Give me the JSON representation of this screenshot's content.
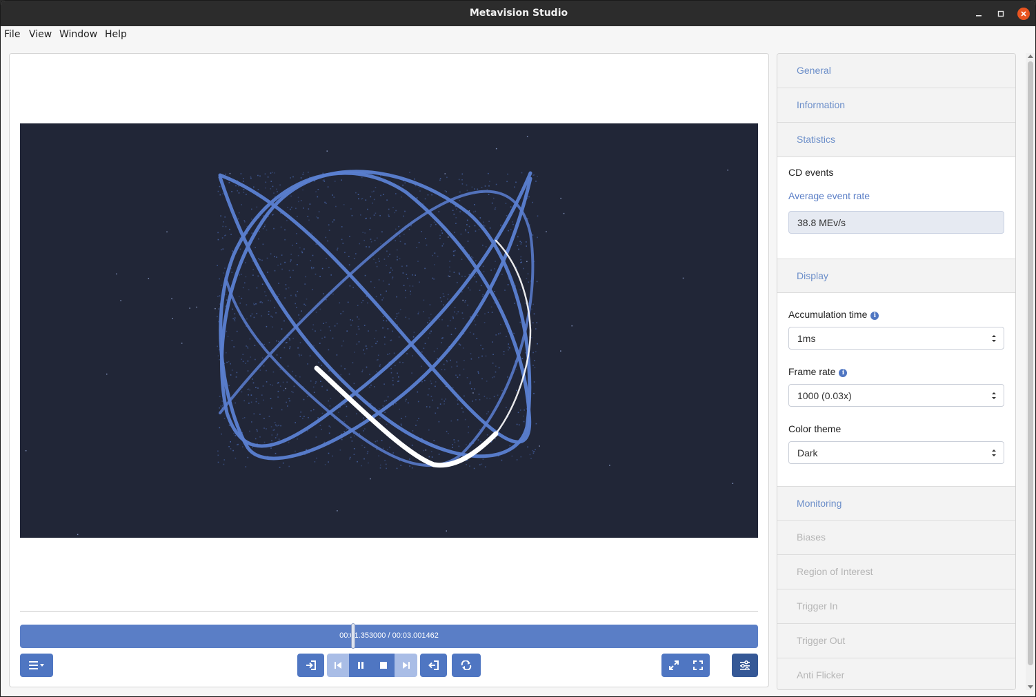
{
  "window": {
    "title": "Metavision Studio"
  },
  "menu": [
    "File",
    "View",
    "Window",
    "Help"
  ],
  "player": {
    "time_display": "00:01.353000 / 00:03.001462",
    "progress": 0.4507
  },
  "sidebar": {
    "sections_top": [
      "General",
      "Information",
      "Statistics"
    ],
    "cd_events_label": "CD events",
    "average_event_rate_label": "Average event rate",
    "average_event_rate_value": "38.8 MEv/s",
    "display_label": "Display",
    "accumulation_time_label": "Accumulation time",
    "accumulation_time_value": "1ms",
    "frame_rate_label": "Frame rate",
    "frame_rate_value": "1000 (0.03x)",
    "color_theme_label": "Color theme",
    "color_theme_value": "Dark",
    "sections_bottom": [
      {
        "label": "Monitoring",
        "enabled": true
      },
      {
        "label": "Biases",
        "enabled": false
      },
      {
        "label": "Region of Interest",
        "enabled": false
      },
      {
        "label": "Trigger In",
        "enabled": false
      },
      {
        "label": "Trigger Out",
        "enabled": false
      },
      {
        "label": "Anti Flicker",
        "enabled": false
      }
    ]
  },
  "colors": {
    "accent": "#4f76c2",
    "canvas_bg": "#212637",
    "event_positive": "#5b7fd1",
    "event_highlight": "#ffffff"
  },
  "icons": {
    "menu": "hamburger-dropdown-icon",
    "enter": "sign-in-icon",
    "skip_back": "skip-back-icon",
    "pause": "pause-icon",
    "stop": "stop-icon",
    "skip_forward": "skip-forward-icon",
    "exit": "sign-out-icon",
    "loop": "repeat-icon",
    "expand": "expand-icon",
    "fullscreen": "fullscreen-icon",
    "settings": "sliders-icon"
  }
}
